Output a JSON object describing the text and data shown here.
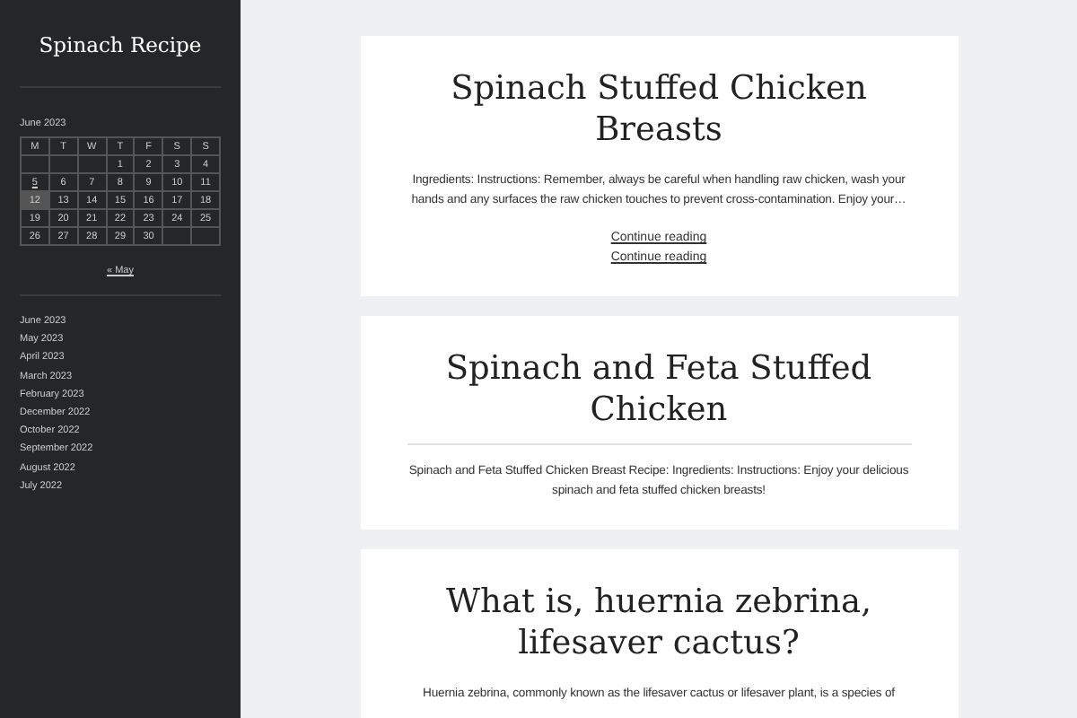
{
  "site_title": "Spinach Recipe",
  "calendar": {
    "caption": "June 2023",
    "weekdays": [
      "M",
      "T",
      "W",
      "T",
      "F",
      "S",
      "S"
    ],
    "weeks": [
      [
        {
          "kind": "blank"
        },
        {
          "kind": "blank"
        },
        {
          "kind": "blank"
        },
        {
          "kind": "day",
          "day": "1",
          "linked": false,
          "today": false
        },
        {
          "kind": "day",
          "day": "2",
          "linked": false,
          "today": false
        },
        {
          "kind": "day",
          "day": "3",
          "linked": false,
          "today": false
        },
        {
          "kind": "day",
          "day": "4",
          "linked": false,
          "today": false
        }
      ],
      [
        {
          "kind": "day",
          "day": "5",
          "linked": true,
          "today": false
        },
        {
          "kind": "day",
          "day": "6",
          "linked": false,
          "today": false
        },
        {
          "kind": "day",
          "day": "7",
          "linked": false,
          "today": false
        },
        {
          "kind": "day",
          "day": "8",
          "linked": false,
          "today": false
        },
        {
          "kind": "day",
          "day": "9",
          "linked": false,
          "today": false
        },
        {
          "kind": "day",
          "day": "10",
          "linked": false,
          "today": false
        },
        {
          "kind": "day",
          "day": "11",
          "linked": false,
          "today": false
        }
      ],
      [
        {
          "kind": "day",
          "day": "12",
          "linked": false,
          "today": true
        },
        {
          "kind": "day",
          "day": "13",
          "linked": false,
          "today": false
        },
        {
          "kind": "day",
          "day": "14",
          "linked": false,
          "today": false
        },
        {
          "kind": "day",
          "day": "15",
          "linked": false,
          "today": false
        },
        {
          "kind": "day",
          "day": "16",
          "linked": false,
          "today": false
        },
        {
          "kind": "day",
          "day": "17",
          "linked": false,
          "today": false
        },
        {
          "kind": "day",
          "day": "18",
          "linked": false,
          "today": false
        }
      ],
      [
        {
          "kind": "day",
          "day": "19",
          "linked": false,
          "today": false
        },
        {
          "kind": "day",
          "day": "20",
          "linked": false,
          "today": false
        },
        {
          "kind": "day",
          "day": "21",
          "linked": false,
          "today": false
        },
        {
          "kind": "day",
          "day": "22",
          "linked": false,
          "today": false
        },
        {
          "kind": "day",
          "day": "23",
          "linked": false,
          "today": false
        },
        {
          "kind": "day",
          "day": "24",
          "linked": false,
          "today": false
        },
        {
          "kind": "day",
          "day": "25",
          "linked": false,
          "today": false
        }
      ],
      [
        {
          "kind": "day",
          "day": "26",
          "linked": false,
          "today": false
        },
        {
          "kind": "day",
          "day": "27",
          "linked": false,
          "today": false
        },
        {
          "kind": "day",
          "day": "28",
          "linked": false,
          "today": false
        },
        {
          "kind": "day",
          "day": "29",
          "linked": false,
          "today": false
        },
        {
          "kind": "day",
          "day": "30",
          "linked": false,
          "today": false
        },
        {
          "kind": "blank"
        },
        {
          "kind": "blank"
        }
      ]
    ],
    "prev_link": "« May"
  },
  "archives": [
    "June 2023",
    "May 2023",
    "April 2023",
    "March 2023",
    "February 2023",
    "December 2022",
    "October 2022",
    "September 2022",
    "August 2022",
    "July 2022"
  ],
  "posts": [
    {
      "title": "Spinach Stuffed Chicken Breasts",
      "divider": false,
      "excerpt": "Ingredients: Instructions: Remember, always be careful when handling raw chicken, wash your hands and any surfaces the raw chicken touches to prevent cross-contamination. Enjoy your…",
      "links": [
        "Continue reading",
        "Continue reading"
      ]
    },
    {
      "title": "Spinach and Feta Stuffed Chicken",
      "divider": true,
      "excerpt": "Spinach and Feta Stuffed Chicken Breast Recipe: Ingredients: Instructions: Enjoy your delicious spinach and feta stuffed chicken breasts!"
    },
    {
      "title": "What is, huernia zebrina, lifesaver cactus?",
      "divider": false,
      "excerpt": "Huernia zebrina, commonly known as the lifesaver cactus or lifesaver plant, is a species of"
    }
  ]
}
